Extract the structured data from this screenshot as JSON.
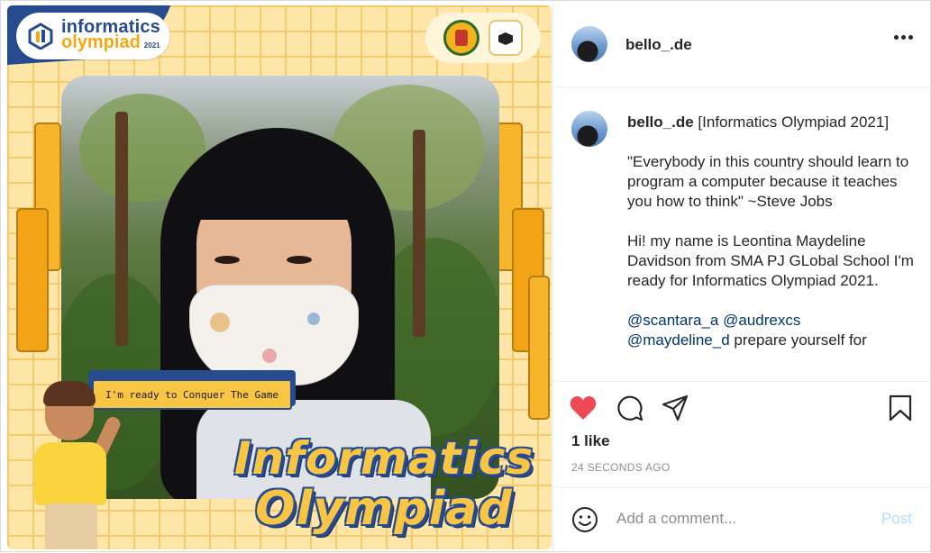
{
  "post_image": {
    "logo_line1": "informatics",
    "logo_line2": "olympiad",
    "logo_year": "2021",
    "banner_text": "I'm ready to Conquer The Game",
    "title_line1": "Informatics",
    "title_line2": "Olympiad"
  },
  "header": {
    "username": "bello_.de"
  },
  "caption": {
    "username": "bello_.de",
    "title": "[Informatics Olympiad 2021]",
    "quote": "\"Everybody in this country should learn to program a computer because it teaches you how to think\" ~Steve Jobs",
    "intro": "Hi! my name is Leontina Maydeline Davidson from SMA PJ GLobal School I'm ready for Informatics Olympiad 2021.",
    "mention1": "@scantara_a",
    "mention2": "@audrexcs",
    "mention3": "@maydeline_d",
    "mention_text": "prepare yourself for"
  },
  "actions": {
    "likes": "1 like",
    "time_ago": "24 SECONDS AGO"
  },
  "comment_box": {
    "placeholder": "Add a comment...",
    "post_label": "Post"
  },
  "colors": {
    "like_red": "#ed4956",
    "post_blue": "#b3dbff",
    "mention_blue": "#00376b"
  },
  "icons": [
    "heart-icon",
    "comment-icon",
    "share-icon",
    "bookmark-icon",
    "more-icon",
    "emoji-icon"
  ]
}
